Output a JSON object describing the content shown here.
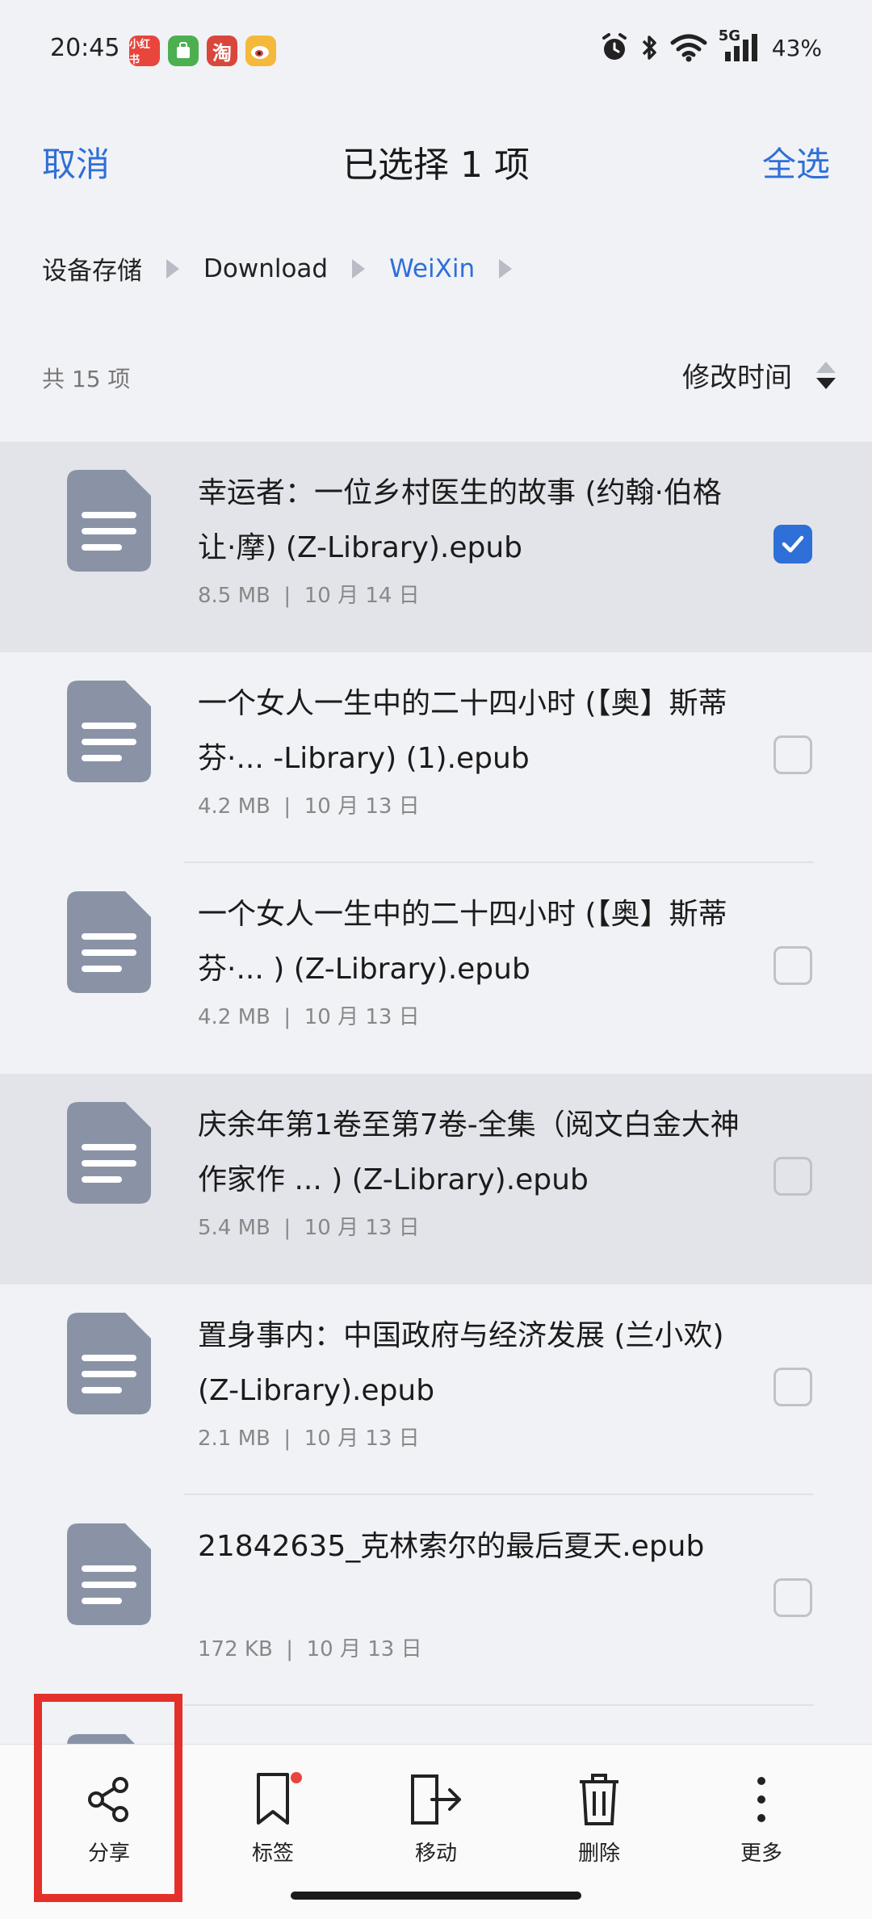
{
  "status_bar": {
    "time": "20:45",
    "network": "5G",
    "battery": "43%",
    "notification_apps": [
      {
        "label": "小红书",
        "color": "#e8453c"
      },
      {
        "label": "",
        "color": "#4caf50"
      },
      {
        "label": "淘",
        "color": "#d9463b"
      },
      {
        "label": "",
        "color": "#f4b93a"
      }
    ]
  },
  "header": {
    "cancel_label": "取消",
    "title": "已选择 1 项",
    "select_all_label": "全选"
  },
  "breadcrumb": [
    "设备存储",
    "Download",
    "WeiXin"
  ],
  "list_header": {
    "count_label": "共 15 项",
    "sort_label": "修改时间"
  },
  "files": [
    {
      "name": "幸运者：一位乡村医生的故事 (约翰·伯格 让·摩) (Z-Library).epub",
      "size": "8.5 MB",
      "date": "10 月 14 日",
      "checked": true,
      "highlighted": true
    },
    {
      "name": "一个女人一生中的二十四小时 (【奥】斯蒂芬·... -Library) (1).epub",
      "size": "4.2 MB",
      "date": "10 月 13 日",
      "checked": false,
      "highlighted": false
    },
    {
      "name": "一个女人一生中的二十四小时 (【奥】斯蒂芬·... ) (Z-Library).epub",
      "size": "4.2 MB",
      "date": "10 月 13 日",
      "checked": false,
      "highlighted": false
    },
    {
      "name": "庆余年第1卷至第7卷-全集（阅文白金大神作家作 ... ) (Z-Library).epub",
      "size": "5.4 MB",
      "date": "10 月 13 日",
      "checked": false,
      "highlighted": true
    },
    {
      "name": "置身事内：中国政府与经济发展 (兰小欢) (Z-Library).epub",
      "size": "2.1 MB",
      "date": "10 月 13 日",
      "checked": false,
      "highlighted": false
    },
    {
      "name": "21842635_克林索尔的最后夏天.epub",
      "size": "172 KB",
      "date": "10 月 13 日",
      "checked": false,
      "highlighted": false
    }
  ],
  "toolbar": {
    "share_label": "分享",
    "tag_label": "标签",
    "move_label": "移动",
    "delete_label": "删除",
    "more_label": "更多"
  },
  "colors": {
    "accent": "#2f6fd8",
    "file_icon": "#8a93a6",
    "highlight_box": "#e4302a",
    "badge_dot": "#e8453c"
  }
}
